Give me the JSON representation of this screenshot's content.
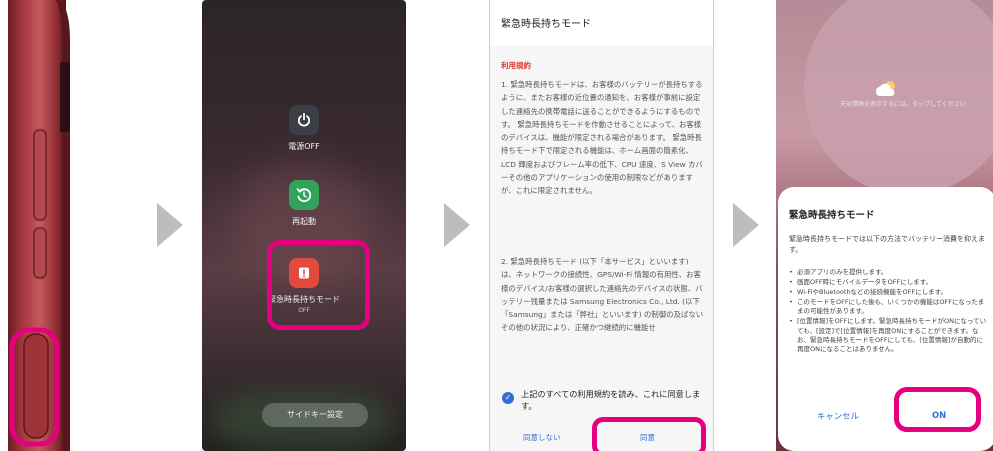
{
  "power_menu": {
    "power_off_label": "電源OFF",
    "restart_label": "再起動",
    "emergency_label": "緊急時長持ちモード",
    "emergency_status": "OFF",
    "side_key_label": "サイドキー設定"
  },
  "terms": {
    "title": "緊急時長持ちモード",
    "section_label": "利用規約",
    "para1": "1. 緊急時長持ちモードは、お客様のバッテリーが長持ちするように、またお客様の近位置の通知を、お客様が事前に設定した連絡先の携帯電話に送ることができるようにするものです。 緊急時長持ちモードを作動させることによって、お客様のデバイスは、機能が限定される場合があります。 緊急時長持ちモード下で限定される機能は、ホーム画面の簡素化、LCD 輝度およびフレーム率の低下、CPU 速度、S View カバーその他のアプリケーションの使用の制限などがありますが、これに限定されません。",
    "para2": "2. 緊急時長持ちモード (以下「本サービス」といいます) は、ネットワークの接続性、GPS/Wi-Fi 情報の有用性、お客様のデバイス/お客様の選択した連絡先のデバイスの状態、バッテリー残量または Samsung Electronics Co., Ltd. (以下「Samsung」または「弊社」といいます) の制御の及ばないその他の状況により、正確かつ継続的に機能せ",
    "agree_text": "上記のすべての利用規約を読み、これに同意します。",
    "disagree_button": "同意しない",
    "agree_button": "同意"
  },
  "dialog": {
    "weather_hint": "天気情報を表示するには、タップしてください",
    "title": "緊急時長持ちモード",
    "intro": "緊急時長持ちモードでは以下の方法でバッテリー消費を抑えます。",
    "bullets": [
      "必須アプリのみを提供します。",
      "画面OFF時にモバイルデータをOFFにします。",
      "Wi-FiやBluetoothなどの接続機能をOFFにします。",
      "このモードをOFFにした後も、いくつかの機能はOFFになったままの可能性があります。",
      "[位置情報]をOFFにします。緊急時長持ちモードがONになっていても、[設定]で[位置情報]を再度ONにすることができます。なお、緊急時長持ちモードをOFFにしても、[位置情報]が自動的に再度ONになることはありません。"
    ],
    "cancel_button": "キャンセル",
    "ok_button": "ON"
  },
  "colors": {
    "highlight": "#e5007f",
    "accent_blue": "#2f6fd6",
    "section_red": "#e03a35",
    "device_red": "#a2363c",
    "arrow_gray": "#bdbdbd"
  },
  "icons": [
    "power-icon",
    "restart-icon",
    "emergency-icon",
    "check-icon",
    "weather-icon",
    "arrow-right-icon"
  ]
}
